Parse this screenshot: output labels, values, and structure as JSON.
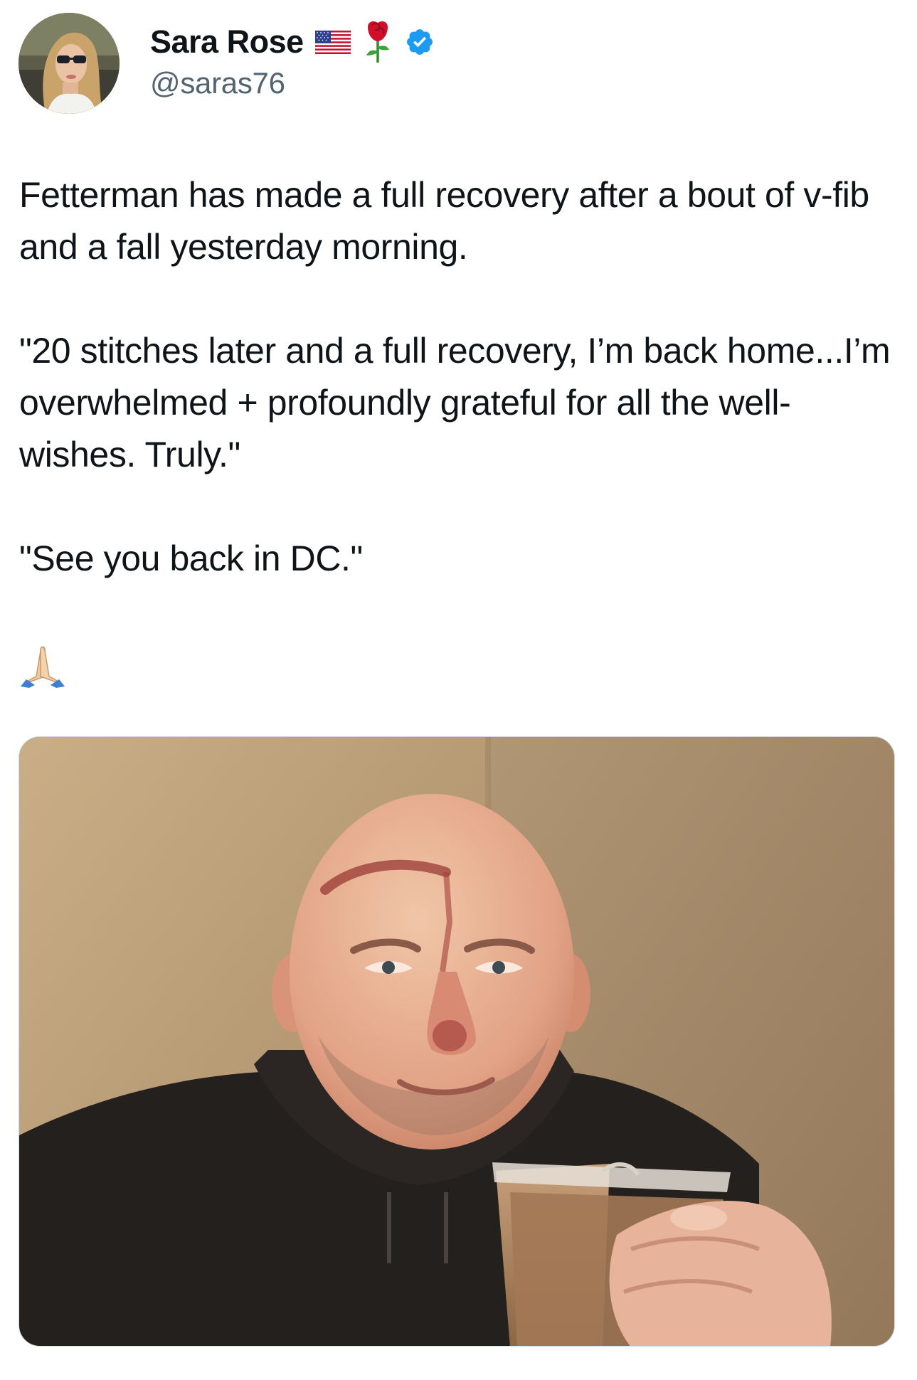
{
  "tweet": {
    "author": {
      "display_name": "Sara Rose",
      "handle": "@saras76",
      "badges": [
        "us-flag-icon",
        "rose-icon",
        "verified-badge-icon"
      ],
      "verified_color": "#1d9bf0"
    },
    "text": {
      "paragraph_1": "Fetterman has made a full recovery after a bout of v-fib and a fall yesterday morning.",
      "paragraph_2": "\"20 stitches later and a full recovery, I’m back home...I’m overwhelmed + profoundly grateful for all the well-wishes. Truly.\"",
      "paragraph_3": "\"See you back in DC.\"",
      "emoji": "folded-hands-icon"
    },
    "media": {
      "type": "photo",
      "description_icon": "photo"
    }
  },
  "colors": {
    "text_primary": "#0f1419",
    "text_secondary": "#536471",
    "accent": "#1d9bf0"
  }
}
